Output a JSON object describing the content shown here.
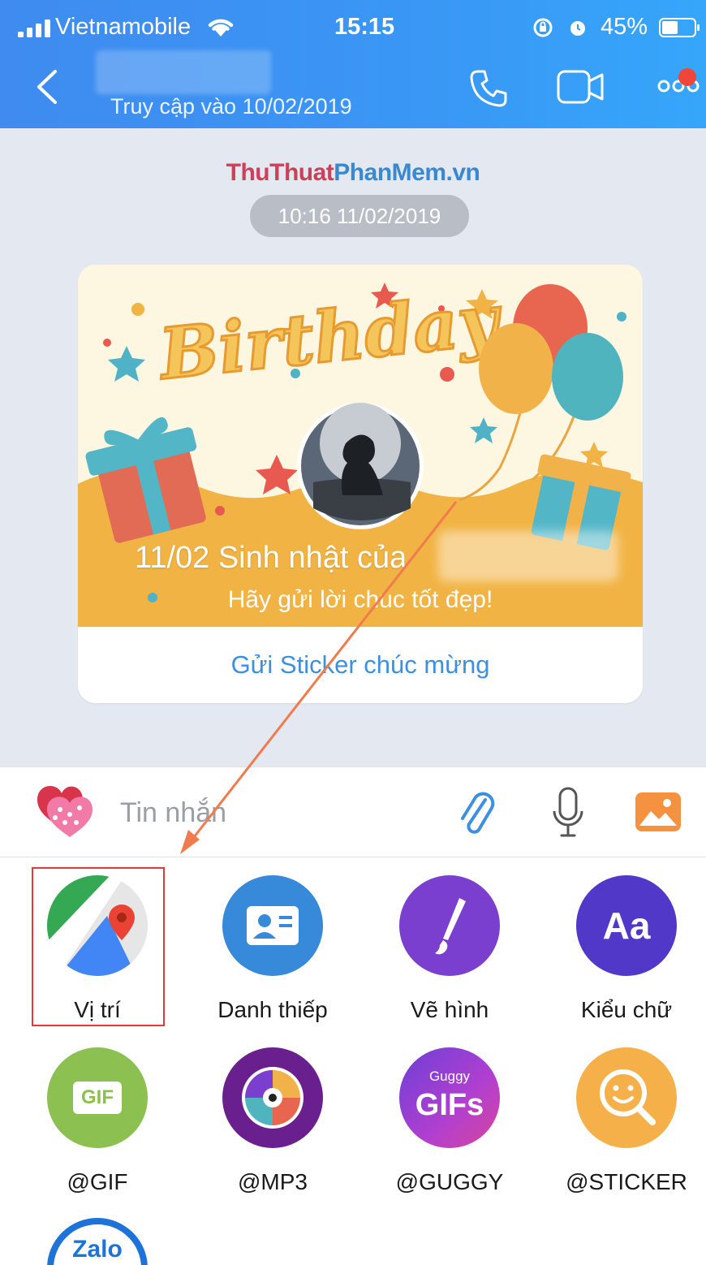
{
  "status_bar": {
    "carrier": "Vietnamobile",
    "time": "15:15",
    "battery_pct": "45%"
  },
  "header": {
    "last_seen": "Truy cập vào 10/02/2019"
  },
  "chat": {
    "watermark_a": "ThuThuat",
    "watermark_b": "PhanMem.vn",
    "date_stamp": "10:16 11/02/2019",
    "card": {
      "banner_text": "Birthday",
      "title": "11/02 Sinh nhật của",
      "subtitle": "Hãy gửi lời chúc tốt đẹp!",
      "action": "Gửi Sticker chúc mừng"
    }
  },
  "composer": {
    "placeholder": "Tin nhắn"
  },
  "grid": {
    "items": [
      {
        "label": "Vị trí",
        "icon": "location-icon"
      },
      {
        "label": "Danh thiếp",
        "icon": "contact-card-icon"
      },
      {
        "label": "Vẽ hình",
        "icon": "brush-icon"
      },
      {
        "label": "Kiểu chữ",
        "icon": "font-style-icon",
        "glyph": "Aa"
      },
      {
        "label": "@GIF",
        "icon": "gif-icon",
        "glyph": "GIF"
      },
      {
        "label": "@MP3",
        "icon": "music-disc-icon"
      },
      {
        "label": "@GUGGY",
        "icon": "guggy-icon",
        "glyph_top": "Guggy",
        "glyph_main": "GIFs"
      },
      {
        "label": "@STICKER",
        "icon": "sticker-search-icon"
      },
      {
        "label": "",
        "icon": "zalo-icon",
        "glyph": "Zalo"
      }
    ]
  },
  "colors": {
    "header": "#3a97f5",
    "accent_link": "#3d8fe0",
    "highlight": "#e53935",
    "arrow": "#f07b4e"
  }
}
